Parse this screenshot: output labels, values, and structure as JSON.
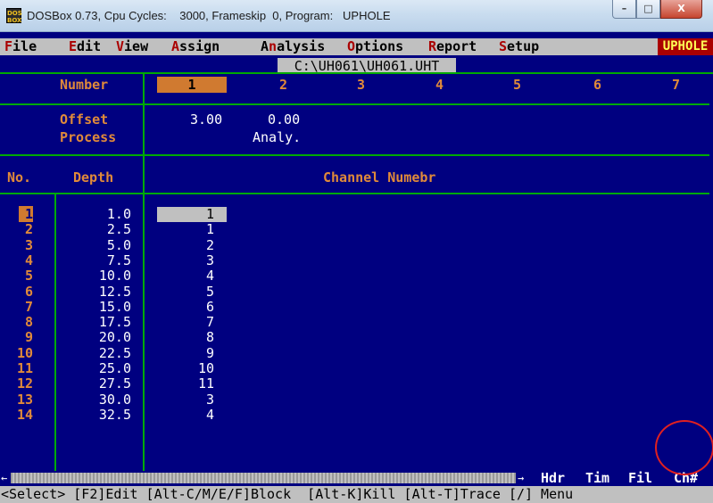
{
  "window": {
    "title": "DOSBox 0.73, Cpu Cycles:    3000, Frameskip  0, Program:   UPHOLE",
    "icon_text": "DOS\nBOX",
    "min_glyph": "–",
    "max_glyph": "□",
    "close_glyph": "X"
  },
  "menu": {
    "items": [
      {
        "hot": "F",
        "rest": "ile"
      },
      {
        "hot": "E",
        "rest": "dit"
      },
      {
        "hot": "V",
        "rest": "iew"
      },
      {
        "hot": "A",
        "rest": "ssign"
      },
      {
        "pre": "A",
        "hot": "n",
        "rest": "alysis"
      },
      {
        "hot": "O",
        "rest": "ptions"
      },
      {
        "hot": "R",
        "rest": "eport"
      },
      {
        "hot": "S",
        "rest": "etup"
      }
    ],
    "app_badge": "UPHOLE"
  },
  "file_path": "C:\\UH061\\UH061.UHT",
  "header": {
    "number_label": "Number",
    "shot_numbers": [
      "1",
      "2",
      "3",
      "4",
      "5",
      "6",
      "7"
    ],
    "selected_shot": "1",
    "offset_label": "Offset",
    "process_label": "Process",
    "offset_values": [
      "3.00",
      "0.00"
    ],
    "process_values": [
      "",
      "Analy."
    ]
  },
  "grid": {
    "col_no": "No.",
    "col_depth": "Depth",
    "col_channel": "Channel Numebr",
    "rows": [
      {
        "no": "1",
        "depth": "1.0",
        "ch": "1"
      },
      {
        "no": "2",
        "depth": "2.5",
        "ch": "1"
      },
      {
        "no": "3",
        "depth": "5.0",
        "ch": "2"
      },
      {
        "no": "4",
        "depth": "7.5",
        "ch": "3"
      },
      {
        "no": "5",
        "depth": "10.0",
        "ch": "4"
      },
      {
        "no": "6",
        "depth": "12.5",
        "ch": "5"
      },
      {
        "no": "7",
        "depth": "15.0",
        "ch": "6"
      },
      {
        "no": "8",
        "depth": "17.5",
        "ch": "7"
      },
      {
        "no": "9",
        "depth": "20.0",
        "ch": "8"
      },
      {
        "no": "10",
        "depth": "22.5",
        "ch": "9"
      },
      {
        "no": "11",
        "depth": "25.0",
        "ch": "10"
      },
      {
        "no": "12",
        "depth": "27.5",
        "ch": "11"
      },
      {
        "no": "13",
        "depth": "30.0",
        "ch": "3"
      },
      {
        "no": "14",
        "depth": "32.5",
        "ch": "4"
      }
    ]
  },
  "scrollbar": {
    "left_arrow": "←",
    "right_arrow": "→"
  },
  "tabs": [
    "Hdr",
    "Tim",
    "Fil",
    "Ch#"
  ],
  "status_line": "<Select> [F2]Edit [Alt-C/M/E/F]Block  [Alt-K]Kill [Alt-T]Trace [/] Menu",
  "colors": {
    "background": "#000080",
    "frame": "#00aa00",
    "accent_orange": "#d07a30",
    "menu_bg": "#c0c0c0",
    "hotkey": "#aa0000",
    "annotation": "#e02020"
  }
}
